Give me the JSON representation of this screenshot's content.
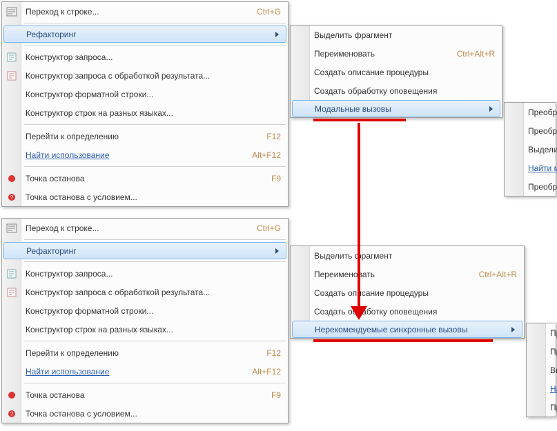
{
  "top": {
    "main": {
      "goto_line": "Переход к строке...",
      "goto_line_sc": "Ctrl+G",
      "refactoring": "Рефакторинг",
      "query_ctor": "Конструктор запроса...",
      "query_ctor_result": "Конструктор запроса с обработкой результата...",
      "format_string": "Конструктор форматной строки...",
      "multilang": "Конструктор строк на разных языках...",
      "goto_def": "Перейти к определению",
      "goto_def_sc": "F12",
      "find_usage": "Найти использование",
      "find_usage_sc": "Alt+F12",
      "breakpoint": "Точка останова",
      "breakpoint_sc": "F9",
      "breakpoint_cond": "Точка останова с условием..."
    },
    "sub": {
      "extract": "Выделить фрагмент",
      "rename": "Переименовать",
      "rename_sc": "Ctrl+Alt+R",
      "create_proc": "Создать описание процедуры",
      "create_handler": "Создать обработку оповещения",
      "modal": "Модальные вызовы"
    },
    "sub2": {
      "i1": "Преобраз",
      "i2": "Преобраз",
      "i3": "Выделит",
      "i4": "Найти мо",
      "i5": "Преобраз"
    }
  },
  "bottom": {
    "main": {
      "goto_line": "Переход к строке...",
      "goto_line_sc": "Ctrl+G",
      "refactoring": "Рефакторинг",
      "query_ctor": "Конструктор запроса...",
      "query_ctor_result": "Конструктор запроса с обработкой результата...",
      "format_string": "Конструктор форматной строки...",
      "multilang": "Конструктор строк на разных языках...",
      "goto_def": "Перейти к определению",
      "goto_def_sc": "F12",
      "find_usage": "Найти использование",
      "find_usage_sc": "Alt+F12",
      "breakpoint": "Точка останова",
      "breakpoint_sc": "F9",
      "breakpoint_cond": "Точка останова с условием..."
    },
    "sub": {
      "extract": "Выделить фрагмент",
      "rename": "Переименовать",
      "rename_sc": "Ctrl+Alt+R",
      "create_proc": "Создать описание процедуры",
      "create_handler": "Создать обработку оповещения",
      "nonrec": "Нерекомендуемые синхронные вызовы"
    },
    "sub2": {
      "i1": "Пр",
      "i2": "Пр",
      "i3": "Вь",
      "i4": "На",
      "i5": "Пр"
    }
  }
}
